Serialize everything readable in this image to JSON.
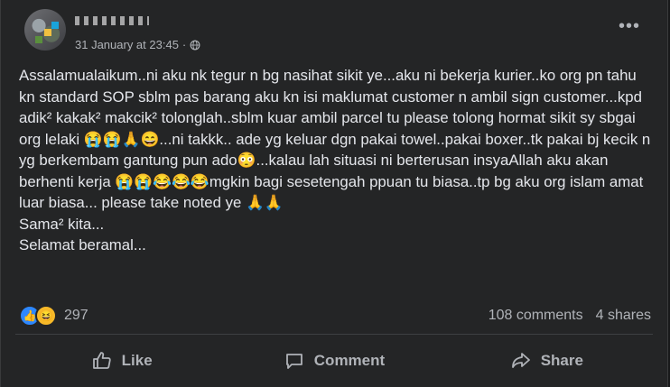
{
  "post": {
    "date": "31 January at 23:45",
    "separator": "·",
    "paragraphs": [
      "Assalamualaikum..ni aku nk tegur n bg nasihat sikit ye...aku ni bekerja kurier..ko org pn tahu kn standard SOP sblm pas barang aku kn isi maklumat customer n ambil sign customer...kpd adik² kakak² makcik² tolonglah..sblm kuar ambil parcel tu please tolong hormat sikit sy sbgai org lelaki 😭😭🙏😄...ni takkk.. ade yg keluar dgn pakai towel..pakai boxer..tk pakai bj kecik n yg berkembam gantung pun ado😳...kalau lah situasi ni berterusan insyaAllah aku akan berhenti kerja 😭😭😂😂😂mgkin bagi sesetengah ppuan tu biasa..tp bg aku org islam amat luar biasa... please take noted ye 🙏🙏",
      "Sama² kita...",
      "Selamat beramal..."
    ]
  },
  "stats": {
    "reactions_count": "297",
    "comments": "108 comments",
    "shares": "4 shares"
  },
  "actions": {
    "like": "Like",
    "comment": "Comment",
    "share": "Share"
  }
}
